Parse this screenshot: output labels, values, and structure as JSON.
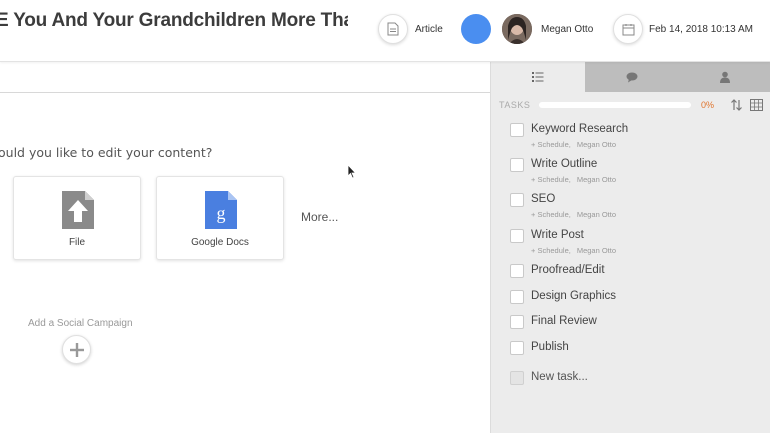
{
  "header": {
    "title": "E You And Your Grandchildren More Tha",
    "type_label": "Article",
    "author": "Megan Otto",
    "date": "Feb 14, 2018 10:13 AM"
  },
  "main": {
    "edit_prompt": "ould you like to edit your content?",
    "cards": [
      {
        "label": "File",
        "icon": "upload-file-icon"
      },
      {
        "label": "Google Docs",
        "icon": "google-docs-icon"
      }
    ],
    "more_label": "More...",
    "social_label": "Add a Social Campaign"
  },
  "sidebar": {
    "tabs": [
      {
        "icon": "list-icon",
        "active": true
      },
      {
        "icon": "chat-bubble-icon",
        "active": false
      },
      {
        "icon": "user-icon",
        "active": false
      }
    ],
    "tasks_label": "TASKS",
    "progress": 0,
    "progress_text": "0%",
    "tasks": [
      {
        "name": "Keyword Research",
        "schedule": "+ Schedule,",
        "assignee": "Megan Otto"
      },
      {
        "name": "Write Outline",
        "schedule": "+ Schedule,",
        "assignee": "Megan Otto"
      },
      {
        "name": "SEO",
        "schedule": "+ Schedule,",
        "assignee": "Megan Otto"
      },
      {
        "name": "Write Post",
        "schedule": "+ Schedule,",
        "assignee": "Megan Otto"
      },
      {
        "name": "Proofread/Edit"
      },
      {
        "name": "Design Graphics"
      },
      {
        "name": "Final Review"
      },
      {
        "name": "Publish"
      }
    ],
    "new_task_label": "New task..."
  },
  "colors": {
    "accent_blue": "#4a8ef0",
    "progress_orange": "#e87a2f",
    "sidebar_bg": "#ececec",
    "tab_inactive": "#bdbdbd"
  }
}
